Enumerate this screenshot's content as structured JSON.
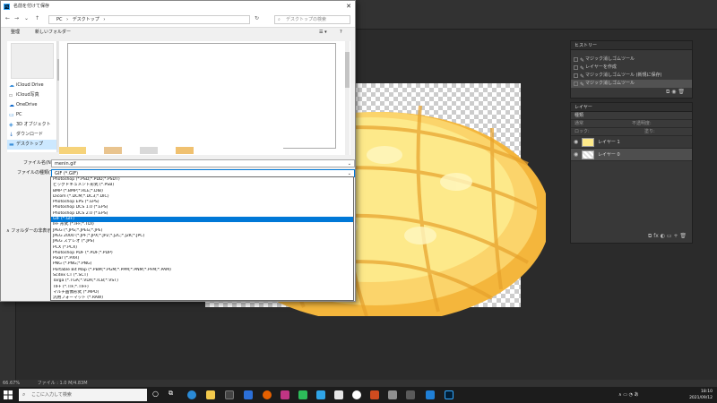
{
  "dialog": {
    "title": "名前を付けて保存",
    "breadcrumb": [
      "PC",
      "デスクトップ"
    ],
    "search_placeholder": "デスクトップの検索",
    "toolbar": {
      "organize": "整理",
      "new_folder": "新しいフォルダー"
    },
    "nav_items": [
      {
        "label": "iCloud Drive",
        "icon": "cloud-icon"
      },
      {
        "label": "iCloud写真",
        "icon": "photos-icon"
      },
      {
        "label": "OneDrive",
        "icon": "onedrive-icon"
      },
      {
        "label": "PC",
        "icon": "pc-icon"
      },
      {
        "label": "3D オブジェクト",
        "icon": "cube-icon"
      },
      {
        "label": "ダウンロード",
        "icon": "download-icon"
      },
      {
        "label": "デスクトップ",
        "icon": "desktop-icon"
      }
    ],
    "filename_label": "ファイル名(N):",
    "filename_value": "menin.gif",
    "filetype_label": "ファイルの種類(T):",
    "filetype_value": "GIF (*.GIF)",
    "hide_folders": "フォルダーの非表示",
    "filetype_options": [
      "Photoshop (*.PSD;*.PDD;*.PSDT)",
      "ビッグドキュメント形式 (*.PSB)",
      "BMP (*.BMP;*.RLE;*.DIB)",
      "Dicom (*.DCM;*.DC3;*.DIC)",
      "Photoshop EPS (*.EPS)",
      "Photoshop DCS 1.0 (*.EPS)",
      "Photoshop DCS 2.0 (*.EPS)",
      "GIF (*.GIF)",
      "IFF 形式 (*.IFF;*.TDI)",
      "JPEG (*.JPG;*.JPEG;*.JPE)",
      "JPEG 2000 (*.JPF;*.JPX;*.JP2;*.J2C;*.J2K;*.JPC)",
      "JPEG ステレオ (*.JPS)",
      "PCX (*.PCX)",
      "Photoshop PDF (*.PDF;*.PDP)",
      "Pixar (*.PXR)",
      "PNG (*.PNG;*.PNG)",
      "Portable Bit Map (*.PBM;*.PGM;*.PPM;*.PNM;*.PFM;*.PAM)",
      "Scitex CT (*.SCT)",
      "Targa (*.TGA;*.VDA;*.ICB;*.VST)",
      "TIFF (*.TIF;*.TIFF)",
      "マルチ画像形式 (*.MPO)",
      "汎用フォーマット (*.RAW)"
    ],
    "selected_option_index": 7
  },
  "history_panel": {
    "tab": "ヒストリー",
    "items": [
      "マジック消しゴムツール",
      "レイヤーを作成",
      "マジック消しゴムツール (新規に保存)",
      "マジック消しゴムツール"
    ]
  },
  "layers_panel": {
    "tab": "レイヤー",
    "kind_label": "種類",
    "blend_label": "通常",
    "opacity_label": "不透明度:",
    "fill_label": "塗り:",
    "lock_label": "ロック:",
    "layers": [
      {
        "name": "レイヤー 1"
      },
      {
        "name": "レイヤー 0"
      }
    ]
  },
  "status_bar": {
    "zoom": "66.67%",
    "file_info": "ファイル : 1.0 M/4.83M"
  },
  "taskbar": {
    "search_placeholder": "ここに入力して検索",
    "time": "18:10",
    "date": "2021/09/12"
  },
  "colors": {
    "selection_blue": "#0078d7",
    "ps_dark": "#323232",
    "panel": "#383838",
    "bread_light": "#fde98a",
    "bread_dark": "#f4b63c"
  }
}
